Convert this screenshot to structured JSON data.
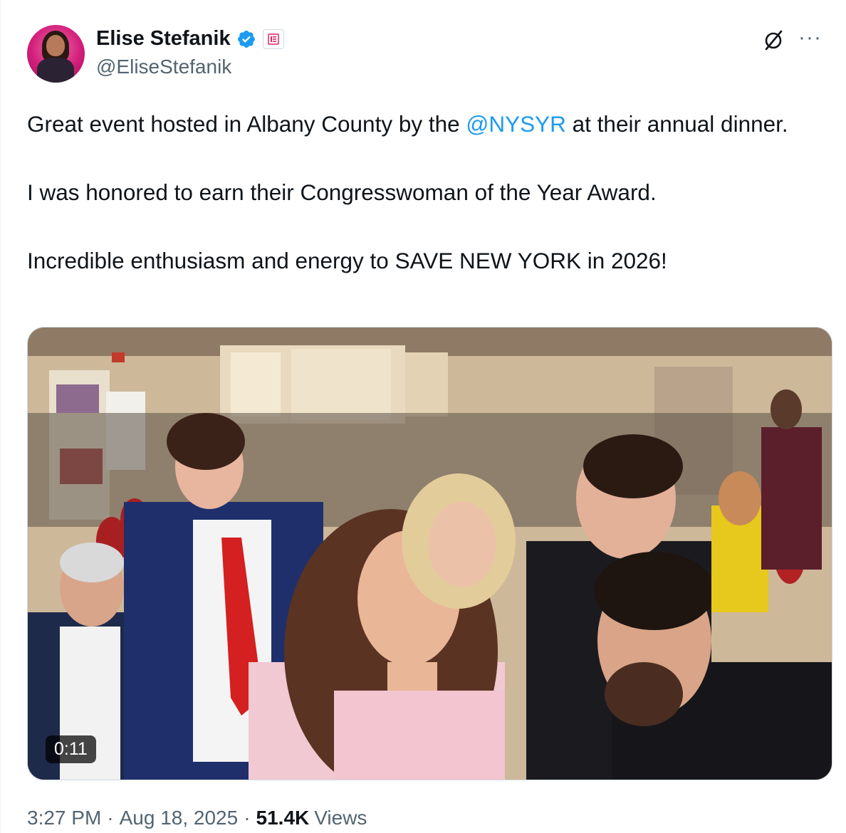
{
  "post": {
    "author": {
      "name": "Elise Stefanik",
      "handle": "@EliseStefanik",
      "verified_icon": "verified-badge-icon",
      "affiliation_icon": "affiliation-badge-icon"
    },
    "actions": {
      "grok_icon": "grok-icon",
      "more_icon": "more-options-icon",
      "more_label": "···"
    },
    "text": {
      "p1_before": "Great event hosted in Albany County by the ",
      "p1_mention": "@NYSYR",
      "p1_after": " at their annual dinner.",
      "p2": "I was honored to earn their Congresswoman of the Year Award.",
      "p3": "Incredible enthusiasm and energy to SAVE NEW YORK in 2026!"
    },
    "media": {
      "type": "video",
      "duration": "0:11"
    },
    "meta": {
      "time": "3:27 PM",
      "separator": "·",
      "date": "Aug 18, 2025",
      "views_count": "51.4K",
      "views_label": "Views"
    }
  },
  "colors": {
    "link": "#1d9bf0",
    "secondary_text": "#536471",
    "primary_text": "#0f1419",
    "verified": "#1d9bf0",
    "affiliation": "#e0245e"
  }
}
